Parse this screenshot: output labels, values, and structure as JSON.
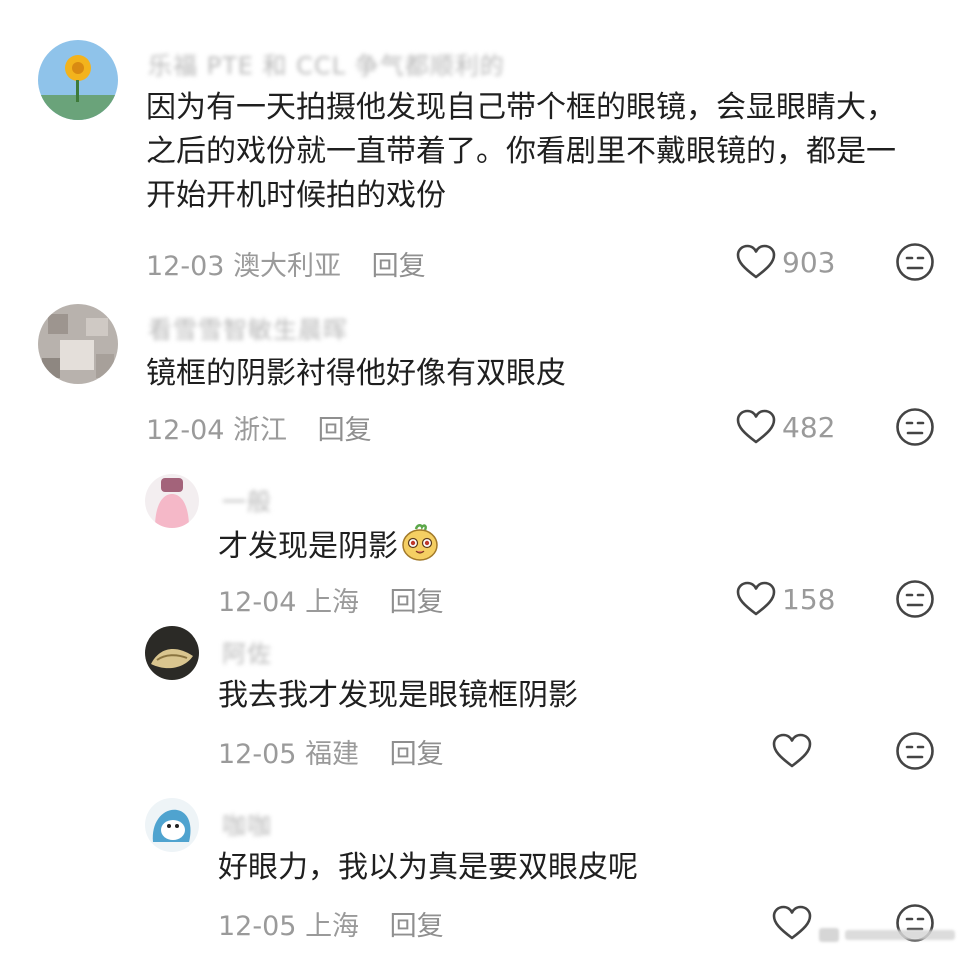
{
  "comments": [
    {
      "username": "乐福 PTE 和 CCL 争气都顺利的",
      "content": [
        "因为有一天拍摄他发现自己带个框的眼镜，会显眼睛大，",
        "之后的戏份就一直带着了。你看剧里不戴眼镜的，都是一",
        "开始开机时候拍的戏份"
      ],
      "date": "12-03",
      "location": "澳大利亚",
      "reply_label": "回复",
      "likes": "903"
    },
    {
      "username": "看雪雪智敏生晨晖",
      "content": [
        "镜框的阴影衬得他好像有双眼皮"
      ],
      "date": "12-04",
      "location": "浙江",
      "reply_label": "回复",
      "likes": "482"
    },
    {
      "username": "一般",
      "content": [
        "才发现是阴影"
      ],
      "date": "12-04",
      "location": "上海",
      "reply_label": "回复",
      "likes": "158"
    },
    {
      "username": "阿佐",
      "content": [
        "我去我才发现是眼镜框阴影"
      ],
      "date": "12-05",
      "location": "福建",
      "reply_label": "回复",
      "likes": ""
    },
    {
      "username": "咖咖",
      "content": [
        "好眼力，我以为真是要双眼皮呢"
      ],
      "date": "12-05",
      "location": "上海",
      "reply_label": "回复",
      "likes": ""
    }
  ],
  "icons": {
    "like": "heart-outline-icon",
    "dislike": "neutral-face-icon",
    "sticker": "cute-face-sticker"
  },
  "colors": {
    "text": "#1f1f1f",
    "meta": "#9a9a9a",
    "icon": "#444444"
  }
}
